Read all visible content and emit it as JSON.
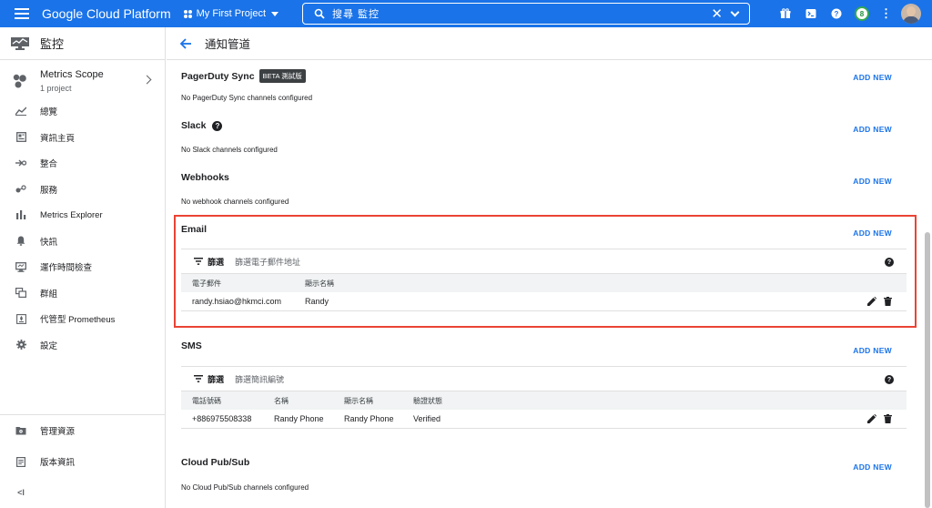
{
  "topbar": {
    "brand": "Google Cloud Platform",
    "project": "My First Project",
    "search_value": "搜尋  監控",
    "clear_symbol": "✕",
    "notification_count": "8"
  },
  "sidebar": {
    "title": "監控",
    "scope": {
      "title": "Metrics Scope",
      "subtitle": "1 project"
    },
    "items": [
      {
        "label": "總覽",
        "icon": "chart-icon"
      },
      {
        "label": "資訊主頁",
        "icon": "dashboard-icon"
      },
      {
        "label": "整合",
        "icon": "integration-icon"
      },
      {
        "label": "服務",
        "icon": "services-icon"
      },
      {
        "label": "Metrics Explorer",
        "icon": "bar-chart-icon"
      },
      {
        "label": "快訊",
        "icon": "bell-icon"
      },
      {
        "label": "運作時間檢查",
        "icon": "monitor-icon"
      },
      {
        "label": "群組",
        "icon": "groups-icon"
      },
      {
        "label": "代管型 Prometheus",
        "icon": "prometheus-icon"
      },
      {
        "label": "設定",
        "icon": "gear-icon"
      }
    ],
    "bottom_items": [
      {
        "label": "管理資源",
        "icon": "folder-icon"
      },
      {
        "label": "版本資訊",
        "icon": "notes-icon"
      }
    ],
    "collapse_symbol": "<I"
  },
  "main": {
    "title": "通知管道",
    "add_new_label": "ADD NEW",
    "sections": {
      "pagerduty": {
        "title": "PagerDuty Sync",
        "badge": "BETA 測試版",
        "empty": "No PagerDuty Sync channels configured"
      },
      "slack": {
        "title": "Slack",
        "empty": "No Slack channels configured"
      },
      "webhooks": {
        "title": "Webhooks",
        "empty": "No webhook channels configured"
      },
      "email": {
        "title": "Email",
        "filter_label": "篩選",
        "filter_placeholder": "篩選電子郵件地址",
        "columns": [
          "電子郵件",
          "顯示名稱"
        ],
        "rows": [
          {
            "email": "randy.hsiao@hkmci.com",
            "display_name": "Randy"
          }
        ]
      },
      "sms": {
        "title": "SMS",
        "filter_label": "篩選",
        "filter_placeholder": "篩選簡訊編號",
        "columns": [
          "電話號碼",
          "名稱",
          "顯示名稱",
          "驗證狀態"
        ],
        "rows": [
          {
            "phone": "+886975508338",
            "name": "Randy Phone",
            "display_name": "Randy Phone",
            "status": "Verified"
          }
        ]
      },
      "pubsub": {
        "title": "Cloud Pub/Sub",
        "empty": "No Cloud Pub/Sub channels configured"
      }
    }
  },
  "colors": {
    "brand_blue": "#1a73e8",
    "highlight_red": "#ea4335"
  }
}
